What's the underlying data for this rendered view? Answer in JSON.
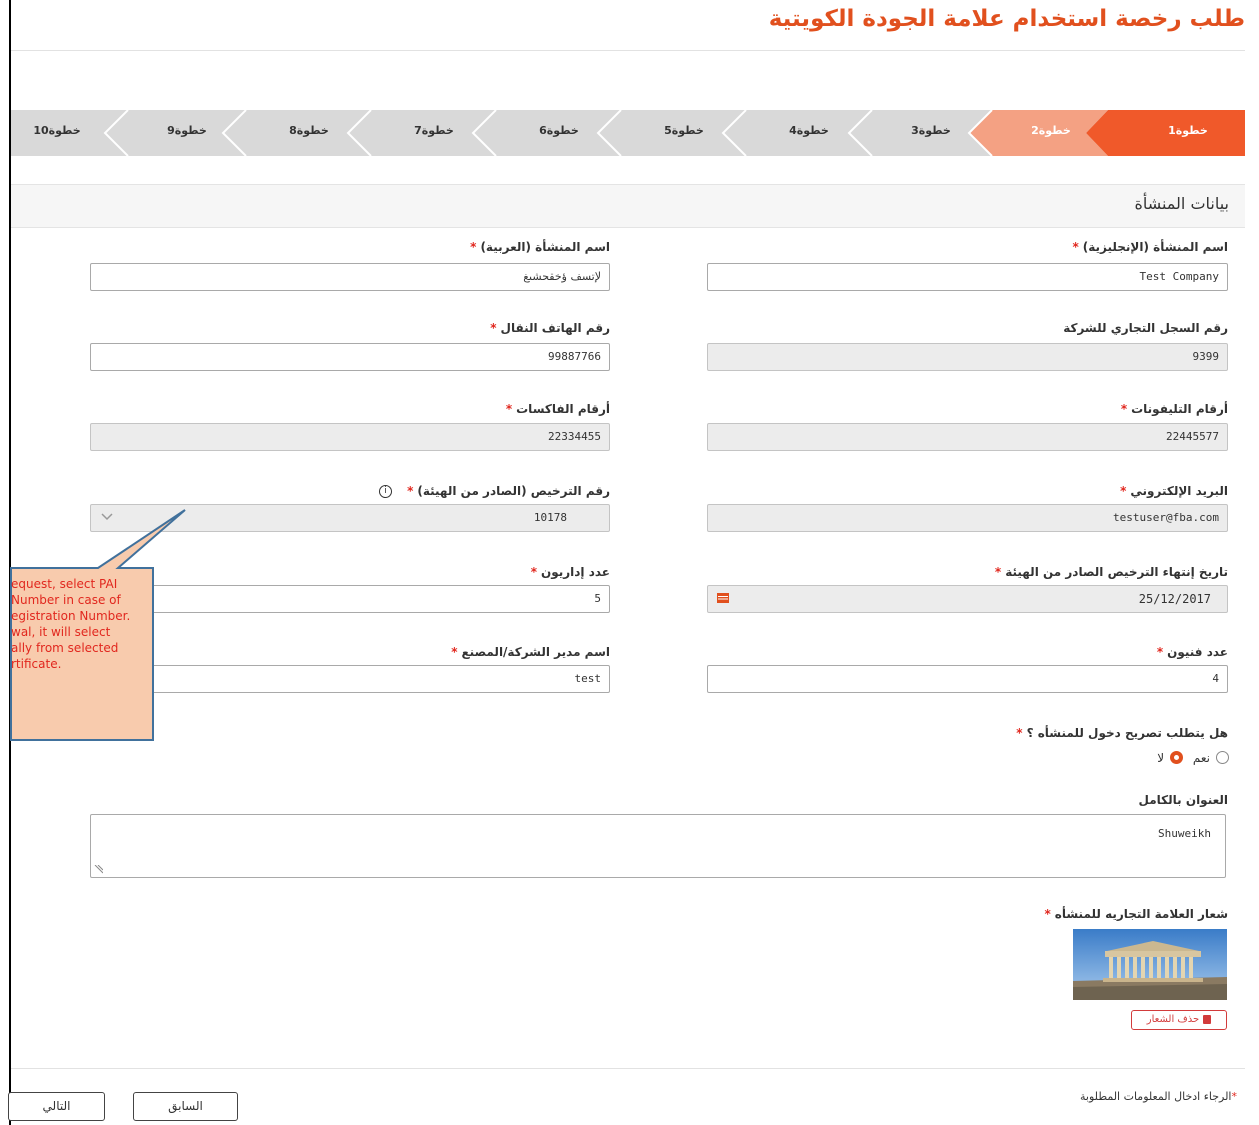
{
  "page_title": "طلب رخصة استخدام علامة الجودة الكويتية",
  "steps": [
    "خطوة1",
    "خطوة2",
    "خطوة3",
    "خطوة4",
    "خطوة5",
    "خطوة6",
    "خطوة7",
    "خطوة8",
    "خطوة9",
    "خطوة10"
  ],
  "active_step": 1,
  "colors": {
    "accent": "#e1501e",
    "step_active": "#f0592a",
    "step_done": "#f4a183",
    "step_inactive": "#d9d9d9",
    "required": "#e1271e"
  },
  "section": {
    "title": "بيانات المنشأة"
  },
  "fields": {
    "name_en": {
      "label": "اسم المنشأة (الإنجليزية)",
      "value": "Test Company"
    },
    "name_ar": {
      "label": "اسم المنشأة (العربية)",
      "value": "لإتسف ؤخقحشىغ"
    },
    "commercial_reg": {
      "label": "رقم السجل التجاري للشركة",
      "value": "9399"
    },
    "mobile": {
      "label": "رقم الهاتف النقال",
      "value": "99887766"
    },
    "phones": {
      "label": "أرقام التليفونات",
      "value": "22445577"
    },
    "fax": {
      "label": "أرقام الفاكسات",
      "value": "22334455"
    },
    "email": {
      "label": "البريد الإلكتروني",
      "value": "testuser@fba.com"
    },
    "license_no": {
      "label": "رقم الترخيص (الصادر من الهيئة)",
      "value": "10178",
      "info": "i"
    },
    "license_expiry": {
      "label": "تاريخ إنتهاء الترخيص الصادر من الهيئة",
      "value": "25/12/2017"
    },
    "admins": {
      "label": "عدد إداريون",
      "value": "5"
    },
    "technicians": {
      "label": "عدد فنيون",
      "value": "4"
    },
    "manager": {
      "label": "اسم مدير الشركة/المصنع",
      "value": "test"
    }
  },
  "entry_permit": {
    "label": "هل يتطلب تصريح دخول للمنشأه ؟",
    "options": [
      "نعم",
      "لا"
    ],
    "selected": "لا"
  },
  "address": {
    "label": "العنوان بالكامل",
    "value": "Shuweikh"
  },
  "logo": {
    "label": "شعار العلامة التجاريه للمنشأه",
    "delete_label": "حذف الشعار"
  },
  "required_mark": "*",
  "footer": {
    "note": "الرجاء ادخال المعلومات المطلوبة",
    "prev": "السابق",
    "next": "التالي"
  },
  "callout": {
    "lines": [
      "equest, select PAI",
      " Number in case of",
      "egistration Number.",
      "wal, it will select",
      "ally from selected",
      "rtificate."
    ]
  }
}
